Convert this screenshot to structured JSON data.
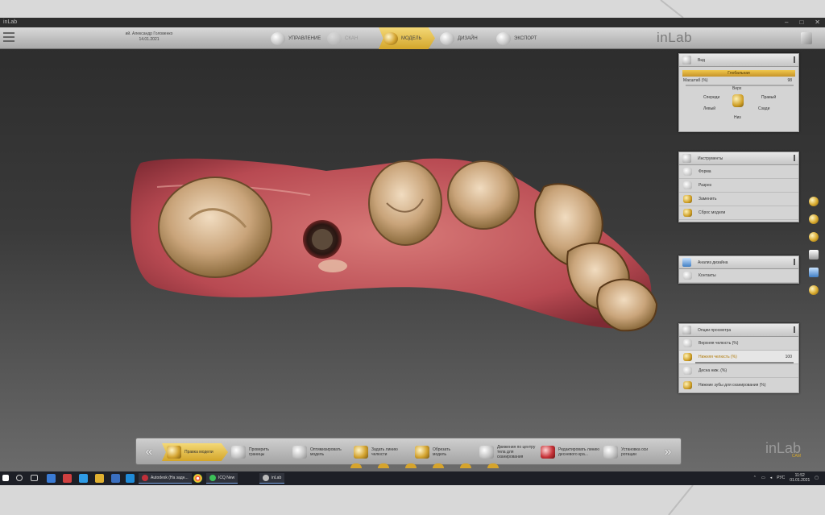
{
  "window": {
    "title": "inLab"
  },
  "header": {
    "user_name": "ий. Александр Головенко",
    "date": "14.01.2021",
    "brand": "inLab",
    "steps": [
      {
        "label": "Управление",
        "state": "normal"
      },
      {
        "label": "Скан",
        "state": "dim"
      },
      {
        "label": "Модель",
        "state": "active"
      },
      {
        "label": "Дизайн",
        "state": "normal"
      },
      {
        "label": "Экспорт",
        "state": "normal"
      }
    ]
  },
  "panels": {
    "view": {
      "title": "Вид",
      "bar_label": "Глобальная",
      "zoom_label": "Масштаб (%)",
      "zoom_value": "98",
      "orientation": {
        "top": "Верх",
        "front": "Спереди",
        "back": "Сзади",
        "right": "Правый",
        "left": "Левый",
        "bottom": "Низ"
      }
    },
    "tools": {
      "title": "Инструменты",
      "items": [
        "Форма",
        "Разрез",
        "Заменить",
        "Сброс модели"
      ]
    },
    "analysis": {
      "title": "Анализ дизайна",
      "items": [
        "Контакты"
      ]
    },
    "display": {
      "title": "Опции просмотра",
      "items": [
        {
          "label": "Верхняя челюсть (%)",
          "value": ""
        },
        {
          "label": "Нижняя челюсть (%)",
          "value": "100"
        },
        {
          "label": "Десна ниж. (%)",
          "value": ""
        },
        {
          "label": "Нижние зубы для сканирования (%)",
          "value": ""
        }
      ]
    }
  },
  "toolbar": {
    "prev": "«",
    "next": "»",
    "tools": [
      {
        "label": "Правка модели",
        "icon": "edit-model-icon",
        "active": true
      },
      {
        "label": "Проверить границы",
        "icon": "check-margin-icon",
        "active": false
      },
      {
        "label": "Оптимизировать модель",
        "icon": "optimize-model-icon",
        "active": false
      },
      {
        "label": "Задать линию челюсти",
        "icon": "jaw-line-icon",
        "active": false
      },
      {
        "label": "Обрезать модель",
        "icon": "trim-model-icon",
        "active": false
      },
      {
        "label": "Движения по центру тела для сканирования",
        "icon": "center-move-icon",
        "active": false
      },
      {
        "label": "Редактировать линию десневого кра...",
        "icon": "gingiva-line-icon",
        "active": false
      },
      {
        "label": "Установка оси ротации",
        "icon": "rotation-axis-icon",
        "active": false
      }
    ]
  },
  "brand_bottom": {
    "name": "inLab",
    "sub": "CAM"
  },
  "taskbar": {
    "apps": [
      {
        "label": "Autodesk (На задн..."
      },
      {
        "label": "ICQ New"
      },
      {
        "label": "inLab"
      }
    ],
    "lang": "РУС",
    "time": "11:52",
    "date": "01.01.2021"
  },
  "colors": {
    "accent": "#d8a92c",
    "gum": "#c85a5e",
    "tooth": "#c9a47a"
  }
}
